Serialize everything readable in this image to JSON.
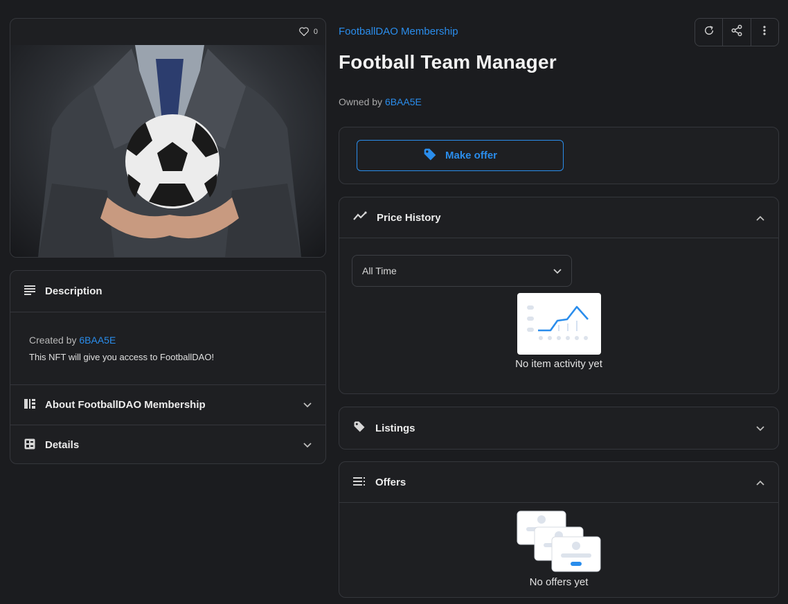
{
  "media": {
    "like_count": "0"
  },
  "description": {
    "title": "Description",
    "created_by_label": "Created by",
    "creator": "6BAA5E",
    "text": "This NFT will give you access to FootballDAO!"
  },
  "about": {
    "title": "About FootballDAO Membership"
  },
  "details": {
    "title": "Details"
  },
  "item": {
    "collection": "FootballDAO Membership",
    "name": "Football Team Manager",
    "owned_by_label": "Owned by",
    "owner": "6BAA5E"
  },
  "offer": {
    "make_offer_label": "Make offer"
  },
  "price_history": {
    "title": "Price History",
    "range_selected": "All Time",
    "empty_text": "No item activity yet"
  },
  "listings": {
    "title": "Listings"
  },
  "offers": {
    "title": "Offers",
    "empty_text": "No offers yet"
  },
  "icons": {
    "heart": "heart-icon",
    "refresh": "refresh-icon",
    "share": "share-icon",
    "more": "more-vertical-icon",
    "tag": "tag-icon",
    "trend": "trend-icon",
    "lines": "lines-icon",
    "chevron_up": "chevron-up-icon",
    "chevron_down": "chevron-down-icon"
  },
  "colors": {
    "accent": "#2a8dec",
    "background": "#1b1c1f",
    "border": "#35373c"
  }
}
